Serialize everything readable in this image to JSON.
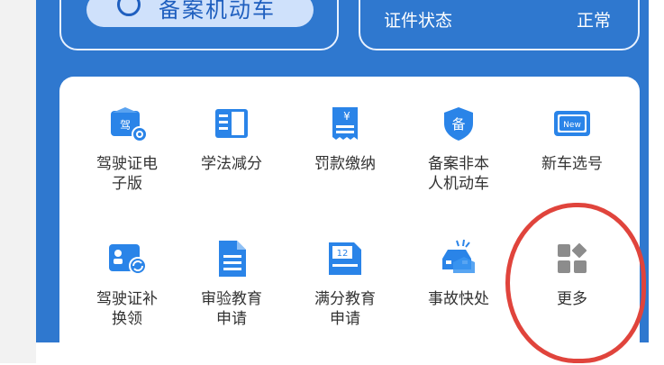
{
  "top": {
    "pill_text": "备案机动车",
    "cert_label": "证件状态",
    "cert_value": "正常"
  },
  "grid": {
    "row1": [
      {
        "label": "驾驶证电\n子版",
        "icon": "driver-license-e-icon",
        "badge": "驾"
      },
      {
        "label": "学法减分",
        "icon": "book-icon"
      },
      {
        "label": "罚款缴纳",
        "icon": "fine-receipt-icon",
        "badge": "¥"
      },
      {
        "label": "备案非本\n人机动车",
        "icon": "registration-shield-icon",
        "badge": "备"
      },
      {
        "label": "新车选号",
        "icon": "new-plate-icon",
        "badge": "New"
      }
    ],
    "row2": [
      {
        "label": "驾驶证补\n换领",
        "icon": "license-renew-icon"
      },
      {
        "label": "审验教育\n申请",
        "icon": "document-icon"
      },
      {
        "label": "满分教育\n申请",
        "icon": "calendar-12-icon",
        "badge": "12"
      },
      {
        "label": "事故快处",
        "icon": "car-accident-icon"
      },
      {
        "label": "更多",
        "icon": "more-grid-icon"
      }
    ]
  },
  "colors": {
    "panel_blue": "#2f78cf",
    "icon_blue": "#2a84e8",
    "highlight_red": "#e0443c"
  }
}
